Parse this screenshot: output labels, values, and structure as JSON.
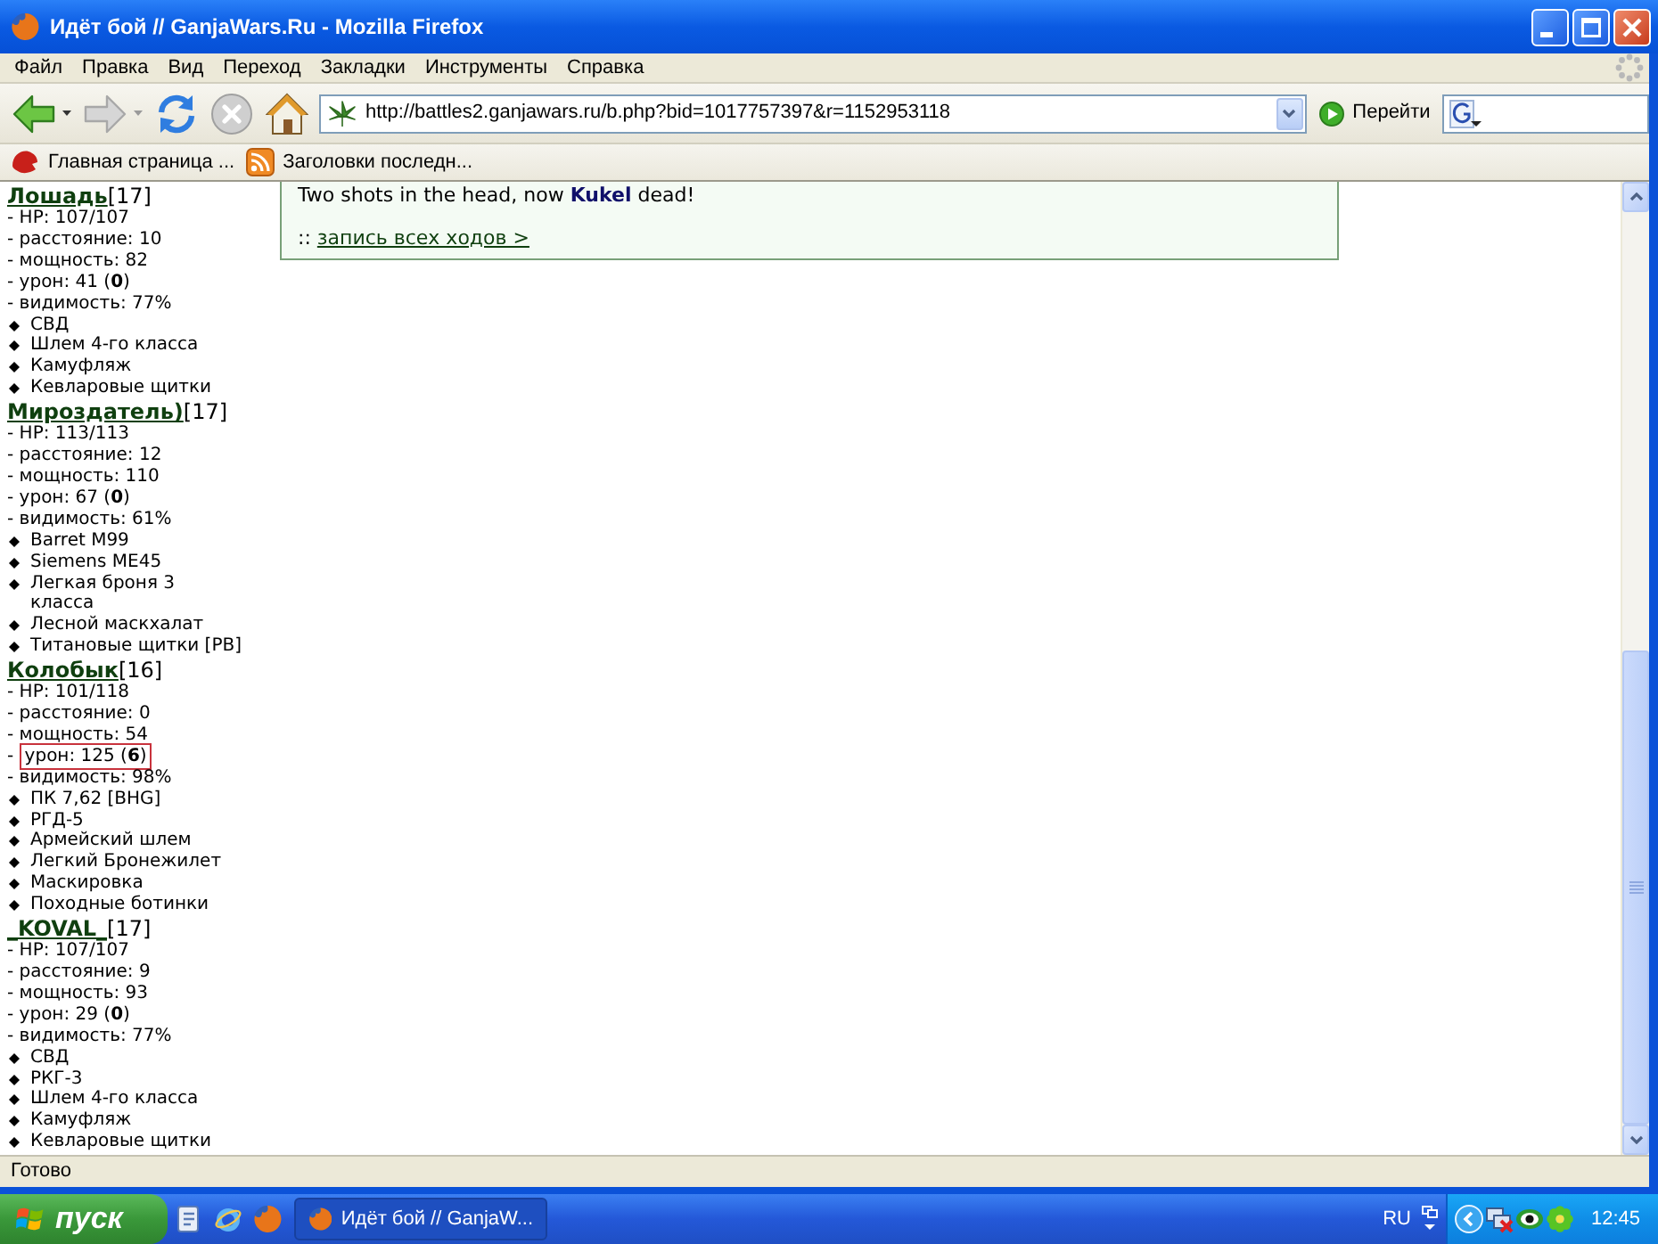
{
  "window": {
    "title": "Идёт бой // GanjaWars.Ru - Mozilla Firefox"
  },
  "menu": [
    "Файл",
    "Правка",
    "Вид",
    "Переход",
    "Закладки",
    "Инструменты",
    "Справка"
  ],
  "nav_toolbar": {
    "buttons": [
      {
        "kind": "back",
        "disabled": false,
        "dropdown": true
      },
      {
        "kind": "forward",
        "disabled": true,
        "dropdown": true
      },
      {
        "kind": "reload",
        "disabled": false,
        "dropdown": false
      },
      {
        "kind": "stop",
        "disabled": true,
        "dropdown": false
      },
      {
        "kind": "home",
        "disabled": false,
        "dropdown": false
      }
    ],
    "url": "http://battles2.ganjawars.ru/b.php?bid=1017757397&r=1152953118",
    "go_button": "Перейти"
  },
  "bookmarks": [
    {
      "kind": "site",
      "label": "Главная страница ..."
    },
    {
      "kind": "feed",
      "label": "Заголовки последн..."
    }
  ],
  "content": {
    "log_box": {
      "line": "Two shots in the head, now **Kukel** dead!",
      "prefix": "::",
      "link": "запись всех ходов >"
    },
    "players": [
      {
        "name": "Лошадь",
        "level": "[17]",
        "stats": [
          {
            "marker": "-",
            "text": "HP: 107/107",
            "highlighted": false
          },
          {
            "marker": "-",
            "text": "расстояние: 10",
            "highlighted": false
          },
          {
            "marker": "-",
            "text": "мощность: 82",
            "highlighted": false
          },
          {
            "marker": "-",
            "text": "урон: 41 (**0**)",
            "highlighted": false
          },
          {
            "marker": "-",
            "text": "видимость: 77%",
            "highlighted": false
          }
        ],
        "items": [
          "СВД",
          "Шлем 4-го класса",
          "Камуфляж",
          "Кевларовые щитки"
        ]
      },
      {
        "name": "Мироздатель)",
        "level": "[17]",
        "stats": [
          {
            "marker": "-",
            "text": "HP: 113/113",
            "highlighted": false
          },
          {
            "marker": "-",
            "text": "расстояние: 12",
            "highlighted": false
          },
          {
            "marker": "-",
            "text": "мощность: 110",
            "highlighted": false
          },
          {
            "marker": "-",
            "text": "урон: 67 (**0**)",
            "highlighted": false
          },
          {
            "marker": "-",
            "text": "видимость: 61%",
            "highlighted": false
          }
        ],
        "items": [
          "Barret M99",
          "Siemens ME45",
          "Легкая броня 3 класса",
          "Лесной маскхалат",
          "Титановые щитки [PB]"
        ]
      },
      {
        "name": "Колобык",
        "level": "[16]",
        "stats": [
          {
            "marker": "-",
            "text": "HP: 101/118",
            "highlighted": false
          },
          {
            "marker": "-",
            "text": "расстояние: 0",
            "highlighted": false
          },
          {
            "marker": "-",
            "text": "мощность: 54",
            "highlighted": false
          },
          {
            "marker": "-",
            "text": "урон: 125 (**6**)",
            "highlighted": true
          },
          {
            "marker": "-",
            "text": "видимость: 98%",
            "highlighted": false
          }
        ],
        "items": [
          "ПК 7,62 [BHG]",
          "РГД-5",
          "Армейский шлем",
          "Легкий Бронежилет",
          "Маскировка",
          "Походные ботинки"
        ]
      },
      {
        "name": "_KOVAL_",
        "level": "[17]",
        "stats": [
          {
            "marker": "-",
            "text": "HP: 107/107",
            "highlighted": false
          },
          {
            "marker": "-",
            "text": "расстояние: 9",
            "highlighted": false
          },
          {
            "marker": "-",
            "text": "мощность: 93",
            "highlighted": false
          },
          {
            "marker": "-",
            "text": "урон: 29 (**0**)",
            "highlighted": false
          },
          {
            "marker": "-",
            "text": "видимость: 77%",
            "highlighted": false
          }
        ],
        "items": [
          "СВД",
          "РКГ-3",
          "Шлем 4-го класса",
          "Камуфляж",
          "Кевларовые щитки"
        ]
      }
    ]
  },
  "status_bar": {
    "text": "Готово"
  },
  "taskbar": {
    "start": "пуск",
    "tasks": [
      {
        "label": "Идёт бой // GanjaW..."
      }
    ],
    "language": "RU",
    "clock": "12:45"
  }
}
